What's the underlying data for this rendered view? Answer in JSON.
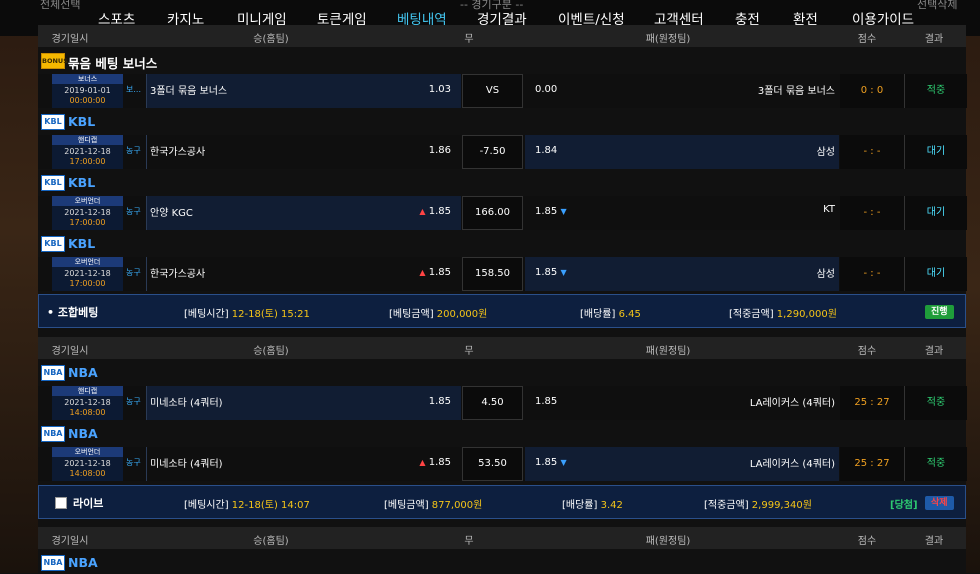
{
  "topbar": {
    "left_text": "전체선택",
    "dropdown_text": "-- 경기구분 --",
    "right_text": "선택삭제"
  },
  "nav": [
    "스포츠",
    "카지노",
    "미니게임",
    "토큰게임",
    "베팅내역",
    "경기결과",
    "이벤트/신청",
    "고객센터",
    "충전",
    "환전",
    "이용가이드"
  ],
  "columns": {
    "date": "경기일시",
    "home": "승(홈팀)",
    "draw": "무",
    "away": "패(원정팀)",
    "score": "점수",
    "result": "결과"
  },
  "leagues": {
    "bonus": "묶음 베팅 보너스",
    "kbl": "KBL",
    "nba": "NBA",
    "bonus_icon": "BONUS",
    "kbl_icon": "KBL",
    "nba_icon": "NBA"
  },
  "rows": [
    {
      "tag": "보너스",
      "date": "2019-01-01",
      "time": "00:00:00",
      "sport": "보...",
      "home": "3폴더 묶음 보너스",
      "home_odds": "1.03",
      "mid": "VS",
      "away_odds": "0.00",
      "away": "3폴더 묶음 보너스",
      "score": "0 : 0",
      "result": "적중"
    },
    {
      "tag": "핸디캡",
      "date": "2021-12-18",
      "time": "17:00:00",
      "sport": "농구",
      "home": "한국가스공사",
      "home_odds": "1.86",
      "mid": "-7.50",
      "away_odds": "1.84",
      "away": "삼성",
      "score": "- : -",
      "result": "대기"
    },
    {
      "tag": "오버언더",
      "date": "2021-12-18",
      "time": "17:00:00",
      "sport": "농구",
      "home": "안양 KGC",
      "home_odds": "1.85",
      "mid": "166.00",
      "away_odds": "1.85",
      "away": "KT",
      "score": "- : -",
      "result": "대기"
    },
    {
      "tag": "오버언더",
      "date": "2021-12-18",
      "time": "17:00:00",
      "sport": "농구",
      "home": "한국가스공사",
      "home_odds": "1.85",
      "mid": "158.50",
      "away_odds": "1.85",
      "away": "삼성",
      "score": "- : -",
      "result": "대기"
    },
    {
      "tag": "핸디캡",
      "date": "2021-12-18",
      "time": "14:08:00",
      "sport": "농구",
      "home": "미네소타 (4쿼터)",
      "home_odds": "1.85",
      "mid": "4.50",
      "away_odds": "1.85",
      "away": "LA레이커스 (4쿼터)",
      "score": "25 : 27",
      "result": "적중"
    },
    {
      "tag": "오버언더",
      "date": "2021-12-18",
      "time": "14:08:00",
      "sport": "농구",
      "home": "미네소타 (4쿼터)",
      "home_odds": "1.85",
      "mid": "53.50",
      "away_odds": "1.85",
      "away": "LA레이커스 (4쿼터)",
      "score": "25 : 27",
      "result": "적중"
    }
  ],
  "summary1": {
    "title": "• 조합베팅",
    "time_label": "[베팅시간]",
    "time": "12-18(토) 15:21",
    "amount_label": "[베팅금액]",
    "amount": "200,000원",
    "odds_label": "[배당률]",
    "odds": "6.45",
    "win_label": "[적중금액]",
    "win": "1,290,000원",
    "status": "진행"
  },
  "summary2": {
    "title": "라이브",
    "time_label": "[베팅시간]",
    "time": "12-18(토) 14:07",
    "amount_label": "[베팅금액]",
    "amount": "877,000원",
    "odds_label": "[배당률]",
    "odds": "3.42",
    "win_label": "[적중금액]",
    "win": "2,999,340원",
    "status": "[당첨]",
    "delete": "삭제"
  }
}
